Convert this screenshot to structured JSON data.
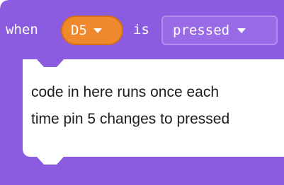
{
  "block": {
    "when_label": "when",
    "pin_dropdown": {
      "value": "D5",
      "icon": "chevron-down-icon"
    },
    "is_label": "is",
    "state_dropdown": {
      "value": "pressed",
      "icon": "chevron-down-icon"
    },
    "comment_line1": "code in here runs once each",
    "comment_line2": "time pin 5 changes to pressed"
  },
  "colors": {
    "block_purple": "#8b5be0",
    "dropdown_orange": "#f0892b",
    "slot_white": "#ffffff"
  }
}
